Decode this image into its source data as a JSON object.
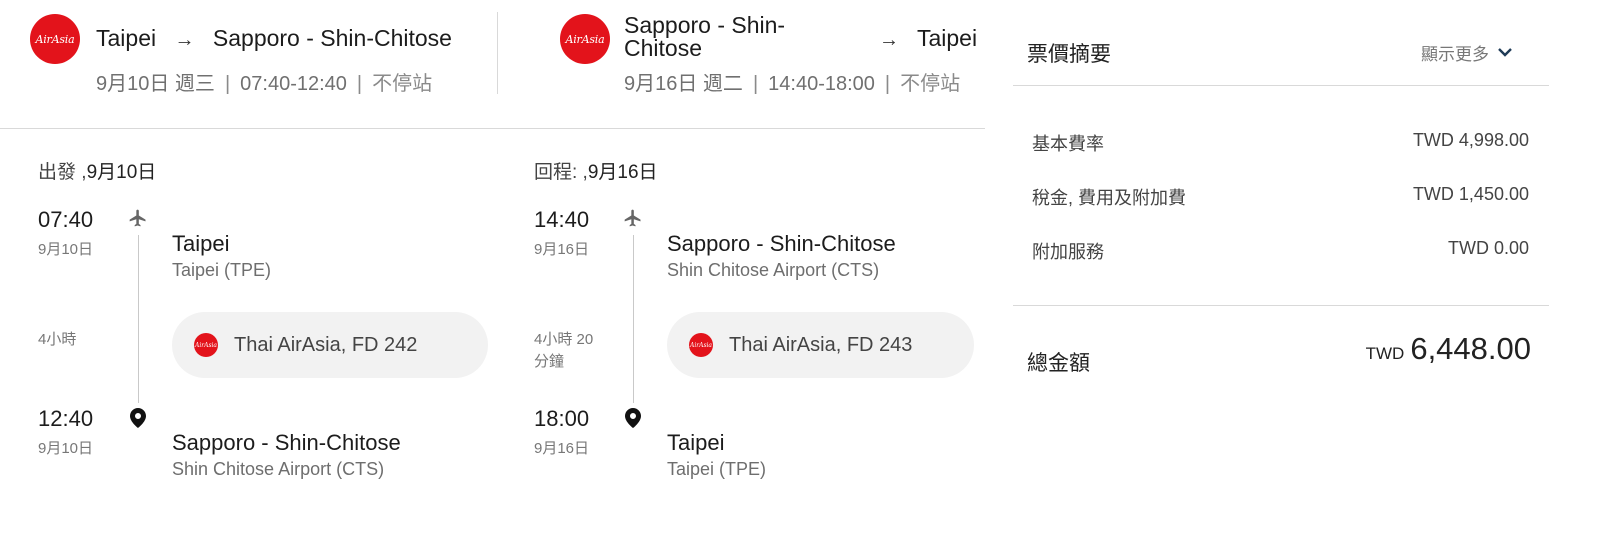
{
  "outbound_header": {
    "logo": "AirAsia",
    "from": "Taipei",
    "arrow": "→",
    "to": "Sapporo - Shin-Chitose",
    "date": "9月10日 週三",
    "times": "07:40-12:40",
    "stops": "不停站"
  },
  "return_header": {
    "logo": "AirAsia",
    "from_line1": "Sapporo - Shin-",
    "from_line2": "Chitose",
    "arrow": "→",
    "to": "Taipei",
    "date": "9月16日 週二",
    "times": "14:40-18:00",
    "stops": "不停站"
  },
  "separator": "|",
  "outbound": {
    "title_prefix": "出發 ,",
    "title_date": "9月10日",
    "dep_time": "07:40",
    "dep_date": "9月10日",
    "dep_city": "Taipei",
    "dep_airport": "Taipei (TPE)",
    "duration_line1": "4小時",
    "duration_line2": "",
    "airline_logo": "AirAsia",
    "flight": "Thai AirAsia, FD 242",
    "arr_time": "12:40",
    "arr_date": "9月10日",
    "arr_city": "Sapporo - Shin-Chitose",
    "arr_airport": "Shin Chitose Airport (CTS)"
  },
  "return": {
    "title_prefix": "回程: ,",
    "title_date": "9月16日",
    "dep_time": "14:40",
    "dep_date": "9月16日",
    "dep_city": "Sapporo - Shin-Chitose",
    "dep_airport": "Shin Chitose Airport (CTS)",
    "duration_line1": "4小時 20",
    "duration_line2": "分鐘",
    "airline_logo": "AirAsia",
    "flight": "Thai AirAsia, FD 243",
    "arr_time": "18:00",
    "arr_date": "9月16日",
    "arr_city": "Taipei",
    "arr_airport": "Taipei (TPE)"
  },
  "summary": {
    "title": "票價摘要",
    "show_more": "顯示更多",
    "rows": [
      {
        "label": "基本費率",
        "value": "TWD 4,998.00"
      },
      {
        "label": "稅金, 費用及附加費",
        "value": "TWD 1,450.00"
      },
      {
        "label": "附加服務",
        "value": "TWD 0.00"
      }
    ],
    "total_label": "總金額",
    "total_currency": "TWD",
    "total_amount": "6,448.00"
  },
  "colors": {
    "brand_red": "#e3131b",
    "text": "#222222",
    "muted": "#777777",
    "divider": "#d9d9d9"
  },
  "icons": [
    "airplane-icon",
    "location-pin-icon",
    "chevron-down-icon"
  ]
}
